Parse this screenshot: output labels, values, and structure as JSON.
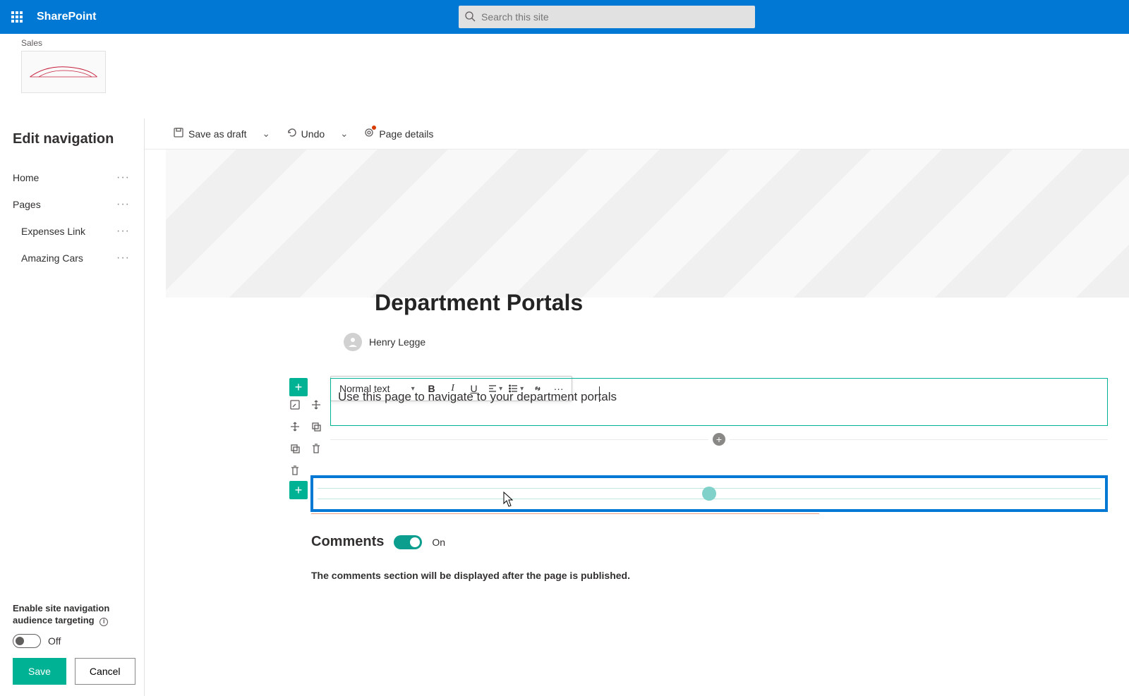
{
  "topbar": {
    "brand": "SharePoint",
    "search_placeholder": "Search this site"
  },
  "siteheader": {
    "breadcrumb": "Sales"
  },
  "nav": {
    "title": "Edit navigation",
    "items": [
      {
        "label": "Home",
        "indent": false
      },
      {
        "label": "Pages",
        "indent": false
      },
      {
        "label": "Expenses Link",
        "indent": true
      },
      {
        "label": "Amazing Cars",
        "indent": true
      }
    ],
    "audience_label": "Enable site navigation audience targeting",
    "audience_state": "Off",
    "save_label": "Save",
    "cancel_label": "Cancel"
  },
  "cmdbar": {
    "save_draft": "Save as draft",
    "undo": "Undo",
    "page_details": "Page details"
  },
  "page": {
    "title": "Department Portals",
    "author": "Henry Legge"
  },
  "format": {
    "style": "Normal text"
  },
  "content": {
    "text": "Use this page to navigate to your department portals"
  },
  "comments": {
    "heading": "Comments",
    "state": "On",
    "note": "The comments section will be displayed after the page is published."
  }
}
